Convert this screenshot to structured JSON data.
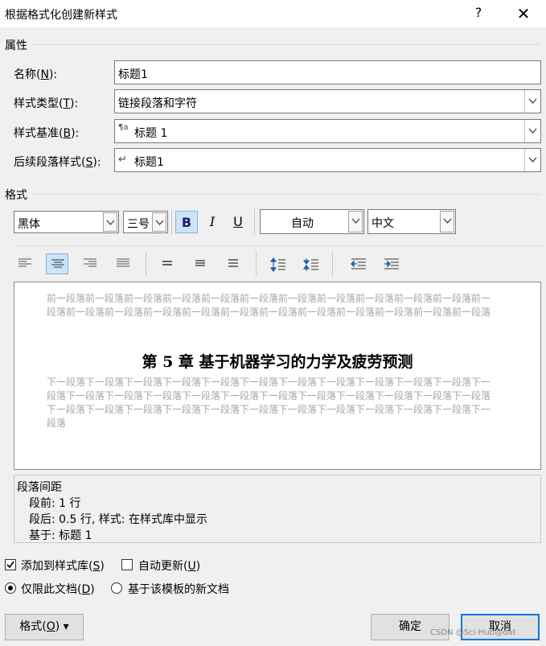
{
  "window": {
    "title": "根据格式化创建新样式",
    "help": "?",
    "close": "✕"
  },
  "properties": {
    "section": "属性",
    "name_label": "名称(",
    "name_key": "N",
    "name_tail": "):",
    "name_value": "标题1",
    "type_label": "样式类型(",
    "type_key": "T",
    "type_tail": "):",
    "type_value": "链接段落和字符",
    "base_label": "样式基准(",
    "base_key": "B",
    "base_tail": "):",
    "base_icon": "¶a",
    "base_value": "标题 1",
    "next_label": "后续段落样式(",
    "next_key": "S",
    "next_tail": "):",
    "next_icon": "↵",
    "next_value": "标题1"
  },
  "format": {
    "section": "格式",
    "font": "黑体",
    "size": "三号",
    "bold": "B",
    "italic": "I",
    "underline": "U",
    "color": "自动",
    "script": "中文"
  },
  "preview": {
    "prev_text": "前一段落前一段落前一段落前一段落前一段落前一段落前一段落前一段落前一段落前一段落前一段落前一段落前一段落前一段落前一段落前一段落前一段落前一段落前一段落前一段落前一段落前一段落前一段落",
    "heading": "第 5 章  基于机器学习的力学及疲劳预测",
    "next_text": "下一段落下一段落下一段落下一段落下一段落下一段落下一段落下一段落下一段落下一段落下一段落下一段落下一段落下一段落下一段落下一段落下一段落下一段落下一段落下一段落下一段落下一段落下一段落下一段落下一段落下一段落下一段落下一段落下一段落下一段落下一段落下一段落下一段落下一段落下一段落"
  },
  "description": {
    "line1": "段落间距",
    "line2": "段前:  1 行",
    "line3": "段后:  0.5 行, 样式: 在样式库中显示",
    "line4": "基于: 标题 1"
  },
  "options": {
    "add_gallery": "添加到样式库(",
    "add_gallery_key": "S",
    "add_gallery_checked": true,
    "auto_update": "自动更新(",
    "auto_update_key": "U",
    "auto_update_checked": false,
    "only_doc": "仅限此文档(",
    "only_doc_key": "D",
    "template": "基于该模板的新文档",
    "selected": "only_doc"
  },
  "buttons": {
    "format": "格式(",
    "format_key": "O",
    "format_tail": ") ▾",
    "ok": "确定",
    "cancel": "取消"
  },
  "watermark": "CSDN @Sci-Hub@dat"
}
